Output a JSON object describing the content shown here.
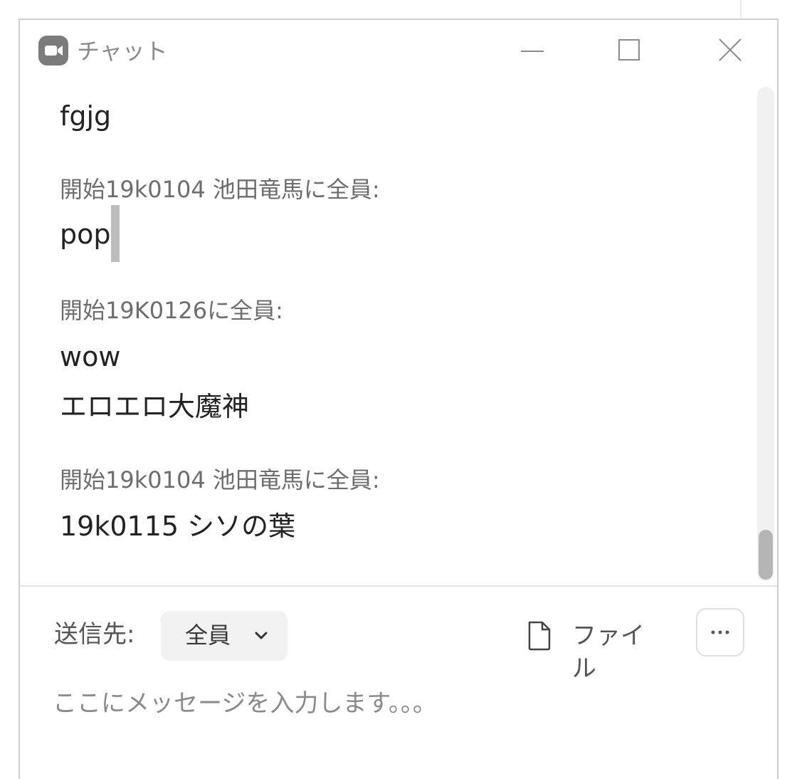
{
  "window": {
    "title": "チャット",
    "icon": "video-camera-icon",
    "controls": [
      "minimize-icon",
      "maximize-icon",
      "close-icon"
    ]
  },
  "messages": {
    "top_text": "fgjg",
    "groups": [
      {
        "header": "開始19k0104 池田竜馬に全員:",
        "lines": [
          "pop"
        ]
      },
      {
        "header": "開始19K0126に全員:",
        "lines": [
          "wow",
          "エロエロ大魔神"
        ]
      },
      {
        "header": "開始19k0104 池田竜馬に全員:",
        "lines": [
          "19k0115 シソの葉"
        ]
      }
    ]
  },
  "composer": {
    "to_label": "送信先:",
    "recipient": "全員",
    "file_label": "ファイル",
    "more_icon": "more-dots-icon",
    "placeholder": "ここにメッセージを入力します。。。"
  },
  "colors": {
    "border": "#cfcfcf",
    "text": "#232323",
    "muted": "#6d6d6d",
    "dropdown_bg": "#f2f2f2"
  }
}
